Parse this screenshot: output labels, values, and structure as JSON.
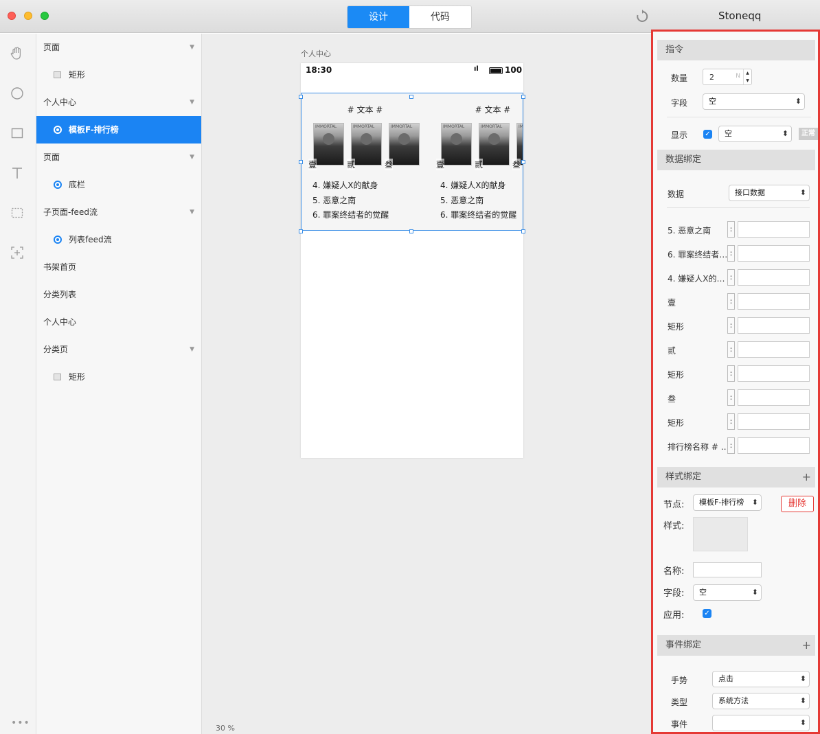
{
  "titlebar": {
    "tabs": [
      {
        "label": "设计",
        "active": true
      },
      {
        "label": "代码",
        "active": false
      }
    ],
    "user": "Stoneqq"
  },
  "rail": {
    "more": "•••"
  },
  "layers": [
    {
      "label": "页面",
      "kind": "group",
      "caret": "▼"
    },
    {
      "label": "矩形",
      "kind": "rect"
    },
    {
      "label": "个人中心",
      "kind": "group",
      "caret": "▼"
    },
    {
      "label": "模板F-排行榜",
      "kind": "radio",
      "selected": true
    },
    {
      "label": "页面",
      "kind": "group",
      "caret": "▼"
    },
    {
      "label": "底栏",
      "kind": "radio"
    },
    {
      "label": "子页面-feed流",
      "kind": "group",
      "caret": "▼"
    },
    {
      "label": "列表feed流",
      "kind": "radio"
    },
    {
      "label": "书架首页",
      "kind": "plain"
    },
    {
      "label": "分类列表",
      "kind": "plain"
    },
    {
      "label": "个人中心",
      "kind": "plain"
    },
    {
      "label": "分类页",
      "kind": "group",
      "caret": "▼"
    },
    {
      "label": "矩形",
      "kind": "rect"
    }
  ],
  "canvas": {
    "page_label": "个人中心",
    "zoom": "30 %",
    "status": {
      "time": "18:30",
      "signal": "ıl",
      "battery": "100"
    },
    "columns": [
      {
        "title": "# 文本 #",
        "ranks": [
          "壹",
          "贰",
          "叁"
        ],
        "items": [
          "4. 嫌疑人X的献身",
          "5. 恶意之南",
          "6. 罪案终结者的觉醒"
        ]
      },
      {
        "title": "# 文本 #",
        "ranks": [
          "壹",
          "贰",
          "叁"
        ],
        "items": [
          "4. 嫌疑人X的献身",
          "5. 恶意之南",
          "6. 罪案终结者的觉醒"
        ]
      }
    ]
  },
  "inspector": {
    "directive": {
      "header": "指令",
      "count_label": "数量",
      "count_value": "2",
      "count_unit": "N",
      "field_label": "字段",
      "field_value": "空",
      "show_label": "显示",
      "show_value": "空",
      "show_badge": "正常"
    },
    "data_binding": {
      "header": "数据绑定",
      "data_label": "数据",
      "data_value": "接口数据",
      "rows": [
        "5. 恶意之南",
        "6. 罪案终结者…",
        "4. 嫌疑人X的…",
        "壹",
        "矩形",
        "贰",
        "矩形",
        "叁",
        "矩形",
        "排行榜名称 # …"
      ],
      "colon": ":"
    },
    "style_binding": {
      "header": "样式绑定",
      "plus": "+",
      "node_label": "节点:",
      "node_value": "模板F-排行榜",
      "delete_label": "删除",
      "style_label": "样式:",
      "name_label": "名称:",
      "field_label": "字段:",
      "field_value": "空",
      "apply_label": "应用:"
    },
    "event_binding": {
      "header": "事件绑定",
      "plus": "+",
      "gesture_label": "手势",
      "gesture_value": "点击",
      "type_label": "类型",
      "type_value": "系统方法",
      "event_label": "事件",
      "event_value": ""
    }
  },
  "colors": {
    "accent": "#1b84f3",
    "highlight_border": "#e53935",
    "selection": "#3a8ee6"
  }
}
